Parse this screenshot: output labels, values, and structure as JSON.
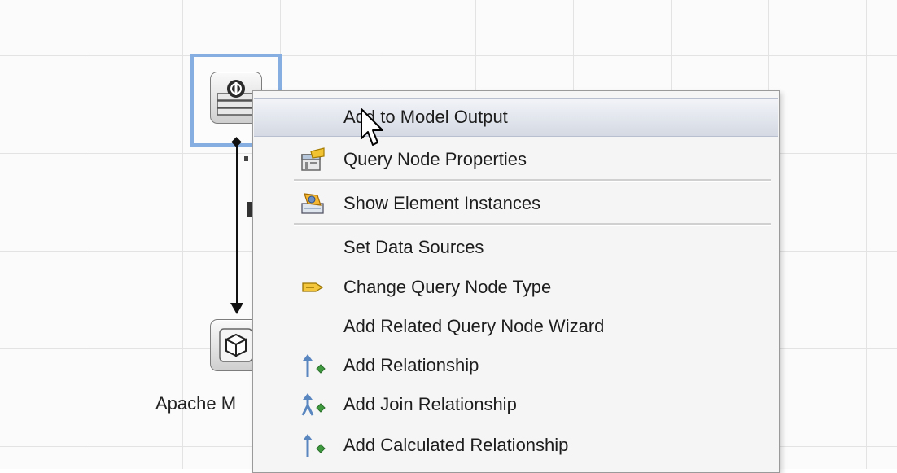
{
  "canvas": {
    "node_label": "Apache M"
  },
  "context_menu": {
    "items": [
      {
        "label": "Add to Model Output",
        "icon": "none",
        "highlighted": true
      },
      {
        "label": "Query Node Properties",
        "icon": "properties-icon"
      },
      {
        "label": "Show Element Instances",
        "icon": "element-instances-icon"
      },
      {
        "label": "Set Data Sources",
        "icon": "none"
      },
      {
        "label": "Change Query Node Type",
        "icon": "change-type-icon"
      },
      {
        "label": "Add Related Query Node Wizard",
        "icon": "none"
      },
      {
        "label": "Add Relationship",
        "icon": "relationship-icon"
      },
      {
        "label": "Add Join Relationship",
        "icon": "join-relationship-icon"
      },
      {
        "label": "Add Calculated Relationship",
        "icon": "calculated-relationship-icon"
      }
    ]
  },
  "colors": {
    "selection_border": "#86aee0",
    "menu_highlight": "#d4d9e3",
    "grid_line": "#e3e3e3"
  }
}
